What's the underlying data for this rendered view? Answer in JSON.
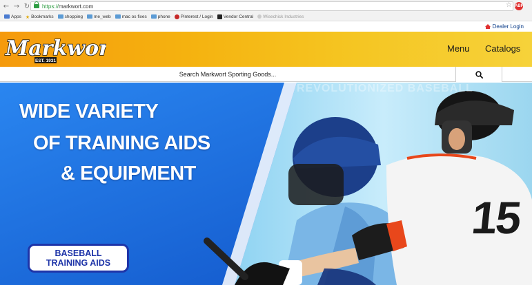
{
  "browser": {
    "url_scheme": "https://",
    "url_host": "markwort.com",
    "extension_badge": "ABP",
    "bookmarks": [
      {
        "label": "Apps",
        "icon": "apps-grid-icon"
      },
      {
        "label": "Bookmarks",
        "icon": "star-icon"
      },
      {
        "label": "shopping",
        "icon": "folder-icon"
      },
      {
        "label": "me_web",
        "icon": "folder-icon"
      },
      {
        "label": "mac os fixes",
        "icon": "folder-icon"
      },
      {
        "label": "phone",
        "icon": "folder-icon"
      },
      {
        "label": "Pinterest / Login",
        "icon": "pinterest-icon"
      },
      {
        "label": "Vendor Central",
        "icon": "vendor-central-icon"
      },
      {
        "label": "Wisechick Industries",
        "icon": "web-icon"
      }
    ]
  },
  "site": {
    "dealer_login": "Dealer Login",
    "logo_text": "Markwort",
    "logo_est": "EST. 1931",
    "nav": {
      "menu": "Menu",
      "catalogs": "Catalogs"
    },
    "search": {
      "placeholder": "Search Markwort Sporting Goods..."
    },
    "hero": {
      "line1": "WIDE VARIETY",
      "line2": "OF TRAINING AIDS",
      "line3": "& EQUIPMENT",
      "cta_line1": "BASEBALL",
      "cta_line2": "TRAINING AIDS",
      "jersey_number": "15",
      "background_text": "REVOLUTIONIZED BASEBALL"
    },
    "colors": {
      "header_gradient_start": "#f59a0d",
      "header_gradient_end": "#f6d23a",
      "hero_blue": "#1e6fe0",
      "cta_border": "#1e34a8",
      "dealer_link": "#0d3e8a"
    }
  }
}
